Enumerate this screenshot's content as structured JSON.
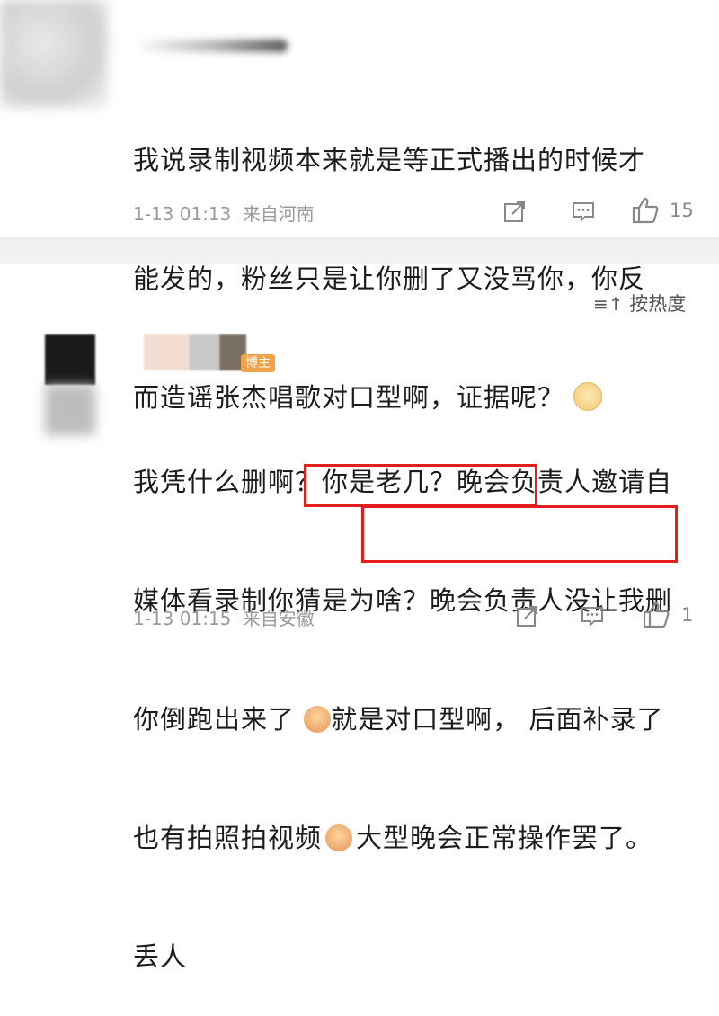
{
  "comment1": {
    "lines": [
      "我说录制视频本来就是等正式播出的时候才",
      "能发的，粉丝只是让你删了又没骂你，你反",
      "而造谣张杰唱歌对口型啊，证据呢？"
    ],
    "emoji": "sad-face",
    "timestamp": "1-13 01:13",
    "location": "来自河南",
    "like_count": "15"
  },
  "sort": {
    "label": "按热度"
  },
  "comment2": {
    "badge": "博主",
    "lines": [
      "我凭什么删啊？你是老几？晚会负责人邀请自",
      "媒体看录制你猜是为啥？晚会负责人没让我删",
      "你倒跑出来了",
      "就是对口型啊，",
      "后面补录了",
      "也有拍照拍视频",
      "大型晚会正常操作罢了。",
      "丢人"
    ],
    "timestamp": "1-13 01:15",
    "location": "来自安徽",
    "like_count": "1"
  },
  "colors": {
    "highlight_box": "#e41e1e",
    "meta_text": "#9a9a9a",
    "badge": "#f0a24a"
  }
}
